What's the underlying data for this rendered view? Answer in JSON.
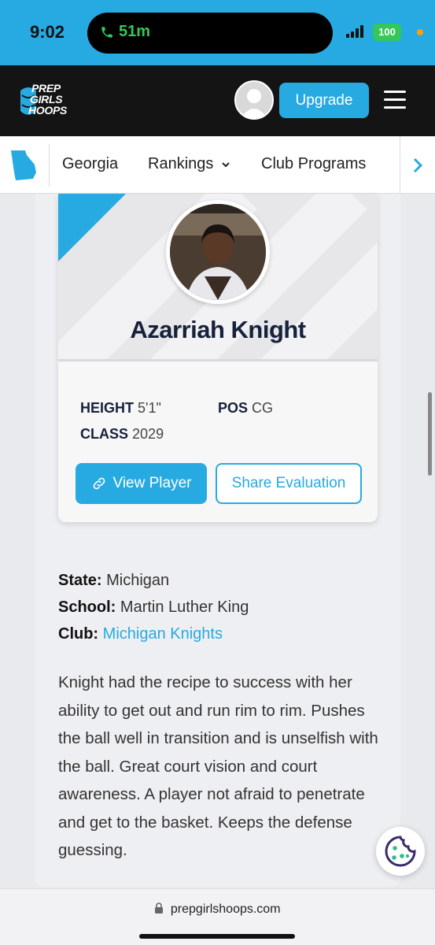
{
  "status_bar": {
    "time": "9:02",
    "call_duration": "51m",
    "battery": "100"
  },
  "header": {
    "logo_lines": [
      "PREP",
      "GIRLS",
      "HOOPS"
    ],
    "upgrade_label": "Upgrade"
  },
  "subnav": {
    "items": [
      {
        "label": "Georgia"
      },
      {
        "label": "Rankings"
      },
      {
        "label": "Club Programs"
      }
    ]
  },
  "player": {
    "name": "Azarriah Knight",
    "height_label": "HEIGHT",
    "height_value": "5'1\"",
    "pos_label": "POS",
    "pos_value": "CG",
    "class_label": "CLASS",
    "class_value": "2029",
    "view_label": "View Player",
    "share_label": "Share Evaluation"
  },
  "info": {
    "state_label": "State:",
    "state_value": "Michigan",
    "school_label": "School:",
    "school_value": "Martin Luther King",
    "club_label": "Club:",
    "club_value": "Michigan Knights"
  },
  "evaluation": "Knight had the recipe to success with her ability to get out and run rim to rim. Pushes the ball well in transition and is unselfish with the ball. Great court vision and court awareness. A player not afraid to penetrate and get to the basket. Keeps the defense guessing.",
  "url": "prepgirlshoops.com",
  "colors": {
    "accent": "#27aae1",
    "header_bg": "#141414",
    "call_green": "#34c759"
  }
}
